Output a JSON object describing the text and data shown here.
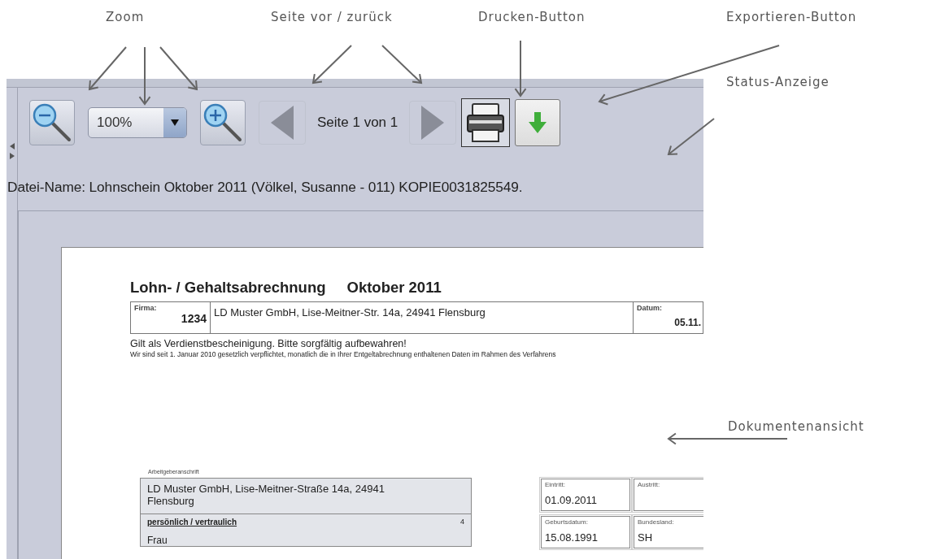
{
  "annotations": [
    {
      "label": "Zoom",
      "kind": "top"
    },
    {
      "label": "Seite vor / zurück",
      "kind": "top"
    },
    {
      "label": "Drucken-Button",
      "kind": "top"
    },
    {
      "label": "Exportieren-Button",
      "kind": "top"
    },
    {
      "label": "Status-Anzeige",
      "kind": "side"
    },
    {
      "label": "Dokumentenansicht",
      "kind": "side"
    }
  ],
  "toolbar": {
    "zoom_select": {
      "value": "100%"
    },
    "page_status": "Seite 1 von 1"
  },
  "file_name": "Datei-Name: Lohnschein Oktober 2011 (Völkel, Susanne - 011) KOPIE0031825549.",
  "document": {
    "title": "Lohn- / Gehaltsabrechnung",
    "period": "Oktober 2011",
    "header": {
      "firma_label": "Firma:",
      "firma_number": "1234",
      "company": "LD Muster GmbH, Lise-Meitner-Str. 14a, 24941 Flensburg",
      "datum_label": "Datum:",
      "datum_value": "05.11."
    },
    "notice": "Gilt als Verdienstbescheinigung. Bitte sorgfältig aufbewahren!",
    "small_notice": "Wir sind seit 1. Januar 2010 gesetzlich verpflichtet, monatlich die in Ihrer Entgeltabrechnung enthaltenen Daten im Rahmen des Verfahrens",
    "employer_label": "Arbeitgeberanschrift",
    "employer_address": "LD Muster GmbH, Lise-Meitner-Straße 14a, 24941 Flensburg",
    "confidential": "persönlich / vertraulich",
    "confidential_number": "4",
    "salutation": "Frau",
    "fields": [
      {
        "label": "Eintritt:",
        "value": "01.09.2011"
      },
      {
        "label": "Austritt:"
      },
      {
        "label": "Geburtsdatum:",
        "value": "15.08.1991"
      },
      {
        "label": "Bundesland:",
        "value": "SH"
      }
    ]
  }
}
